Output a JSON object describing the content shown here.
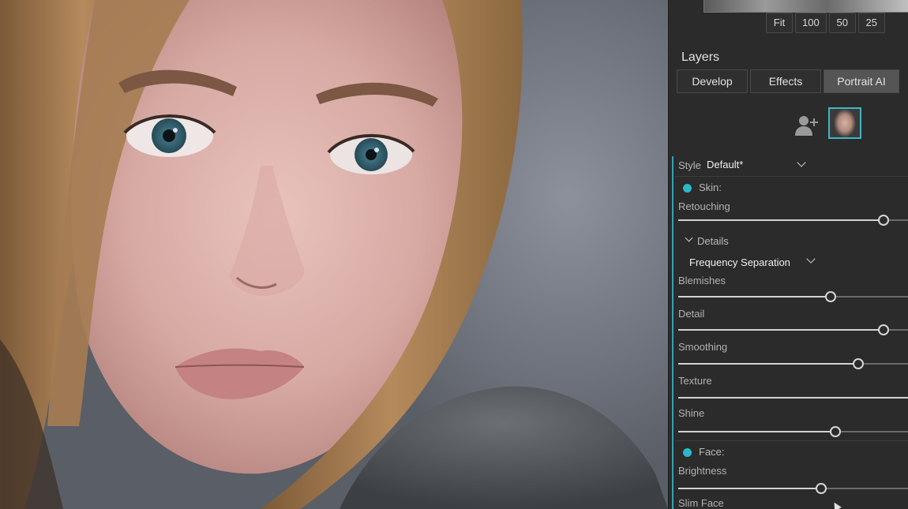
{
  "zoom": {
    "buttons": [
      "Fit",
      "100",
      "50",
      "25"
    ]
  },
  "layers": {
    "title": "Layers",
    "tabs": [
      {
        "label": "Develop",
        "active": false
      },
      {
        "label": "Effects",
        "active": false
      },
      {
        "label": "Portrait AI",
        "active": true
      }
    ]
  },
  "portrait": {
    "style_label": "Style",
    "style_value": "Default*",
    "skin_section": "Skin:",
    "retouching_label": "Retouching",
    "retouching_value": 0.89,
    "details_label": "Details",
    "method_value": "Frequency Separation",
    "sliders": [
      {
        "label": "Blemishes",
        "value": 0.66
      },
      {
        "label": "Detail",
        "value": 0.89
      },
      {
        "label": "Smoothing",
        "value": 0.78
      },
      {
        "label": "Texture",
        "value": null
      },
      {
        "label": "Shine",
        "value": 0.68
      }
    ],
    "face_section": "Face:",
    "brightness_label": "Brightness",
    "brightness_value": 0.62,
    "slim_face_label": "Slim Face"
  },
  "colors": {
    "accent": "#2bb7c8",
    "panel_bg": "#2b2b2b"
  },
  "icons": {
    "add_person": "add-person-icon",
    "face_thumbnail": "face-thumbnail",
    "dropdown": "chevron-down-icon"
  }
}
